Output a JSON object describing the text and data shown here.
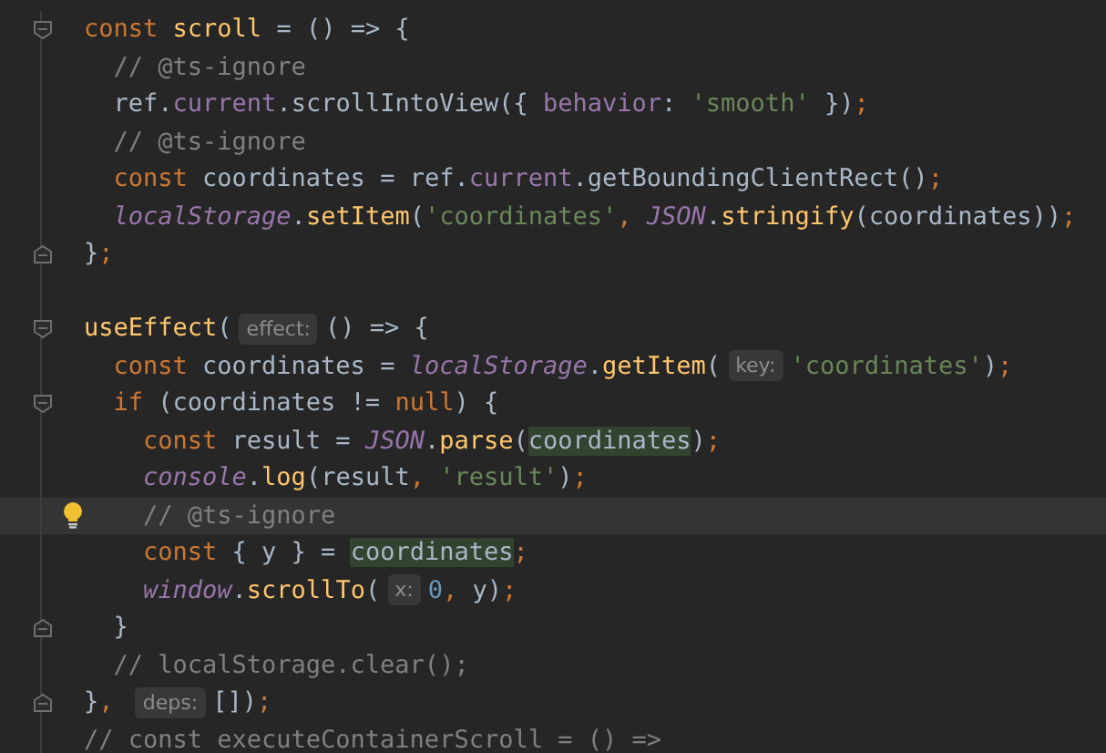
{
  "editor": {
    "lines": [
      {
        "fold_open": true,
        "fold_close": false,
        "current_line": false,
        "intention_bulb": false,
        "tokens": [
          {
            "kind": "kw",
            "t": "const "
          },
          {
            "kind": "fn",
            "t": "scroll"
          },
          {
            "kind": "plain",
            "t": " = () => {"
          }
        ]
      },
      {
        "fold_open": false,
        "fold_close": false,
        "current_line": false,
        "intention_bulb": false,
        "tokens": [
          {
            "kind": "comment",
            "t": "  // @ts-ignore"
          }
        ]
      },
      {
        "fold_open": false,
        "fold_close": false,
        "current_line": false,
        "intention_bulb": false,
        "tokens": [
          {
            "kind": "plain",
            "t": "  ref."
          },
          {
            "kind": "prop",
            "t": "current"
          },
          {
            "kind": "plain",
            "t": ".scrollIntoView({ "
          },
          {
            "kind": "prop",
            "t": "behavior"
          },
          {
            "kind": "plain",
            "t": ": "
          },
          {
            "kind": "str",
            "t": "'smooth'"
          },
          {
            "kind": "plain",
            "t": " })"
          },
          {
            "kind": "kw",
            "t": ";"
          }
        ]
      },
      {
        "fold_open": false,
        "fold_close": false,
        "current_line": false,
        "intention_bulb": false,
        "tokens": [
          {
            "kind": "comment",
            "t": "  // @ts-ignore"
          }
        ]
      },
      {
        "fold_open": false,
        "fold_close": false,
        "current_line": false,
        "intention_bulb": false,
        "tokens": [
          {
            "kind": "kw",
            "t": "  const"
          },
          {
            "kind": "plain",
            "t": " coordinates = ref."
          },
          {
            "kind": "prop",
            "t": "current"
          },
          {
            "kind": "plain",
            "t": ".getBoundingClientRect()"
          },
          {
            "kind": "kw",
            "t": ";"
          }
        ]
      },
      {
        "fold_open": false,
        "fold_close": false,
        "current_line": false,
        "intention_bulb": false,
        "tokens": [
          {
            "kind": "global",
            "t": "  localStorage"
          },
          {
            "kind": "plain",
            "t": "."
          },
          {
            "kind": "fn",
            "t": "setItem"
          },
          {
            "kind": "plain",
            "t": "("
          },
          {
            "kind": "str",
            "t": "'coordinates'"
          },
          {
            "kind": "kw",
            "t": ", "
          },
          {
            "kind": "global",
            "t": "JSON"
          },
          {
            "kind": "plain",
            "t": "."
          },
          {
            "kind": "fn",
            "t": "stringify"
          },
          {
            "kind": "plain",
            "t": "(coordinates))"
          },
          {
            "kind": "kw",
            "t": ";"
          }
        ]
      },
      {
        "fold_open": false,
        "fold_close": true,
        "current_line": false,
        "intention_bulb": false,
        "tokens": [
          {
            "kind": "plain",
            "t": "}"
          },
          {
            "kind": "kw",
            "t": ";"
          }
        ]
      },
      {
        "fold_open": false,
        "fold_close": false,
        "current_line": false,
        "intention_bulb": false
      },
      {
        "fold_open": true,
        "fold_close": false,
        "current_line": false,
        "intention_bulb": false,
        "tokens": [
          {
            "kind": "fn",
            "t": "useEffect"
          },
          {
            "kind": "plain",
            "t": "("
          },
          {
            "kind": "hint",
            "t": "effect:"
          },
          {
            "kind": "plain",
            "t": "() => {"
          }
        ]
      },
      {
        "fold_open": false,
        "fold_close": false,
        "current_line": false,
        "intention_bulb": false,
        "tokens": [
          {
            "kind": "kw",
            "t": "  const"
          },
          {
            "kind": "plain",
            "t": " coordinates = "
          },
          {
            "kind": "global",
            "t": "localStorage"
          },
          {
            "kind": "plain",
            "t": "."
          },
          {
            "kind": "fn",
            "t": "getItem"
          },
          {
            "kind": "plain",
            "t": "("
          },
          {
            "kind": "hint",
            "t": "key:"
          },
          {
            "kind": "str",
            "t": "'coordinates'"
          },
          {
            "kind": "plain",
            "t": ")"
          },
          {
            "kind": "kw",
            "t": ";"
          }
        ]
      },
      {
        "fold_open": true,
        "fold_close": false,
        "current_line": false,
        "intention_bulb": false,
        "tokens": [
          {
            "kind": "kw",
            "t": "  if"
          },
          {
            "kind": "plain",
            "t": " (coordinates != "
          },
          {
            "kind": "kw",
            "t": "null"
          },
          {
            "kind": "plain",
            "t": ") {"
          }
        ]
      },
      {
        "fold_open": false,
        "fold_close": false,
        "current_line": false,
        "intention_bulb": false,
        "tokens": [
          {
            "kind": "kw",
            "t": "    const"
          },
          {
            "kind": "plain",
            "t": " result = "
          },
          {
            "kind": "global",
            "t": "JSON"
          },
          {
            "kind": "plain",
            "t": "."
          },
          {
            "kind": "fn",
            "t": "parse"
          },
          {
            "kind": "plain",
            "t": "("
          },
          {
            "kind": "mark",
            "t": "coordinates"
          },
          {
            "kind": "plain",
            "t": ")"
          },
          {
            "kind": "kw",
            "t": ";"
          }
        ]
      },
      {
        "fold_open": false,
        "fold_close": false,
        "current_line": false,
        "intention_bulb": false,
        "tokens": [
          {
            "kind": "global",
            "t": "    console"
          },
          {
            "kind": "plain",
            "t": "."
          },
          {
            "kind": "fn",
            "t": "log"
          },
          {
            "kind": "plain",
            "t": "(result"
          },
          {
            "kind": "kw",
            "t": ", "
          },
          {
            "kind": "str",
            "t": "'result'"
          },
          {
            "kind": "plain",
            "t": ")"
          },
          {
            "kind": "kw",
            "t": ";"
          }
        ]
      },
      {
        "fold_open": false,
        "fold_close": false,
        "current_line": true,
        "intention_bulb": true,
        "tokens": [
          {
            "kind": "comment",
            "t": "    // @ts-ignore"
          }
        ]
      },
      {
        "fold_open": false,
        "fold_close": false,
        "current_line": false,
        "intention_bulb": false,
        "tokens": [
          {
            "kind": "kw",
            "t": "    const"
          },
          {
            "kind": "plain",
            "t": " { y } = "
          },
          {
            "kind": "mark",
            "t": "coordinates"
          },
          {
            "kind": "kw",
            "t": ";"
          }
        ]
      },
      {
        "fold_open": false,
        "fold_close": false,
        "current_line": false,
        "intention_bulb": false,
        "tokens": [
          {
            "kind": "global",
            "t": "    window"
          },
          {
            "kind": "plain",
            "t": "."
          },
          {
            "kind": "fn",
            "t": "scrollTo"
          },
          {
            "kind": "plain",
            "t": "("
          },
          {
            "kind": "hint",
            "t": "x:"
          },
          {
            "kind": "num",
            "t": "0"
          },
          {
            "kind": "kw",
            "t": ", "
          },
          {
            "kind": "plain",
            "t": "y)"
          },
          {
            "kind": "kw",
            "t": ";"
          }
        ]
      },
      {
        "fold_open": false,
        "fold_close": true,
        "current_line": false,
        "intention_bulb": false,
        "tokens": [
          {
            "kind": "plain",
            "t": "  }"
          }
        ]
      },
      {
        "fold_open": false,
        "fold_close": false,
        "current_line": false,
        "intention_bulb": false,
        "tokens": [
          {
            "kind": "comment",
            "t": "  // localStorage.clear();"
          }
        ]
      },
      {
        "fold_open": false,
        "fold_close": true,
        "current_line": false,
        "intention_bulb": false,
        "tokens": [
          {
            "kind": "plain",
            "t": "}"
          },
          {
            "kind": "kw",
            "t": ", "
          },
          {
            "kind": "hint",
            "t": "deps:"
          },
          {
            "kind": "plain",
            "t": "[])"
          },
          {
            "kind": "kw",
            "t": ";"
          }
        ]
      },
      {
        "fold_open": false,
        "fold_close": false,
        "current_line": false,
        "intention_bulb": false,
        "tokens": [
          {
            "kind": "comment",
            "t": "// const executeContainerScroll = () =>"
          }
        ]
      }
    ]
  }
}
